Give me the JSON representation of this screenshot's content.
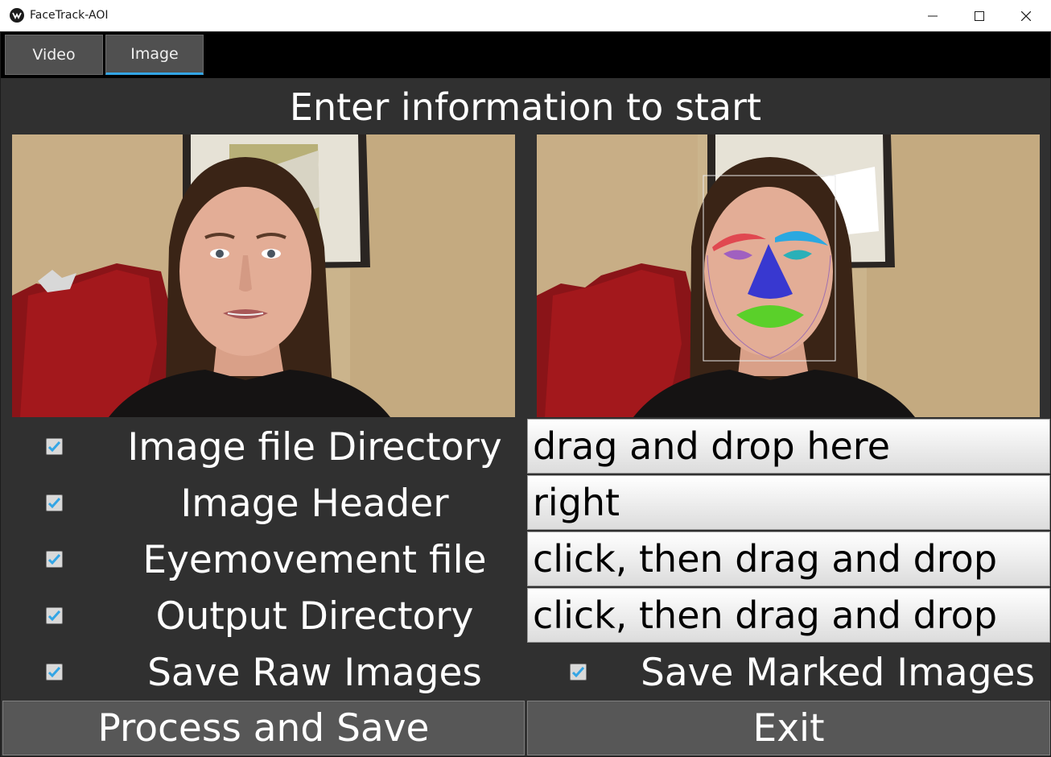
{
  "window": {
    "title": "FaceTrack-AOI"
  },
  "tabs": [
    {
      "label": "Video"
    },
    {
      "label": "Image"
    }
  ],
  "heading": "Enter information to start",
  "rows": [
    {
      "label": "Image file Directory",
      "value": "drag and drop here",
      "checked": true
    },
    {
      "label": "Image Header",
      "value": "right",
      "checked": true
    },
    {
      "label": "Eyemovement file",
      "value": "click, then drag and drop",
      "checked": true
    },
    {
      "label": "Output Directory",
      "value": "click, then drag and drop",
      "checked": true
    }
  ],
  "save_raw": {
    "label": "Save Raw Images",
    "checked": true
  },
  "save_marked": {
    "label": "Save Marked Images",
    "checked": true
  },
  "buttons": {
    "process": "Process and Save",
    "exit": "Exit"
  },
  "colors": {
    "background": "#303030",
    "accent": "#33a5e5",
    "aoi_left_brow": "#e04850",
    "aoi_right_brow": "#2aa8e0",
    "aoi_left_eye": "#a060c0",
    "aoi_right_eye": "#2ab0b8",
    "aoi_nose": "#3838d0",
    "aoi_mouth": "#5ad02a"
  },
  "icons": [
    "app-logo-icon",
    "minimize-icon",
    "maximize-icon",
    "close-icon",
    "checkmark-icon"
  ]
}
